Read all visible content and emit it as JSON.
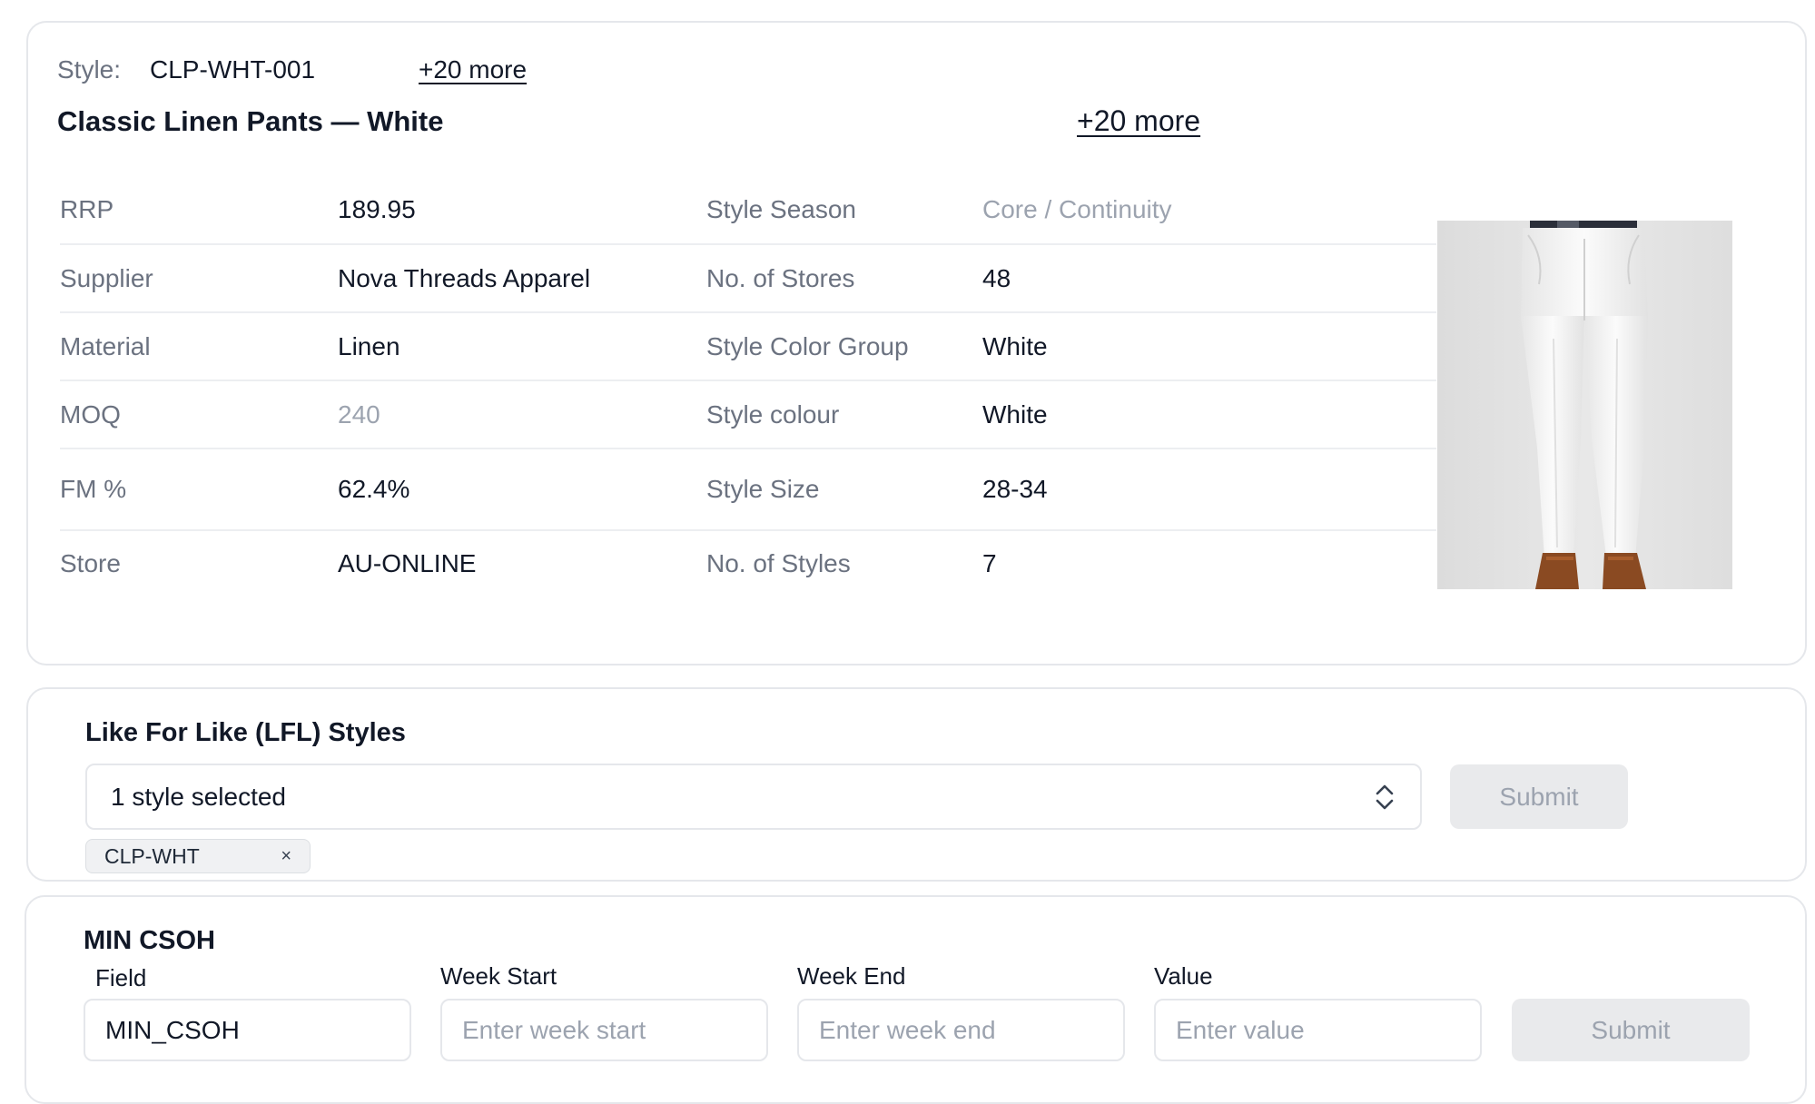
{
  "product": {
    "style_key": "Style:",
    "style_code": "CLP-WHT-001",
    "more_top": "+20 more",
    "title": "Classic Linen Pants — White",
    "more_title": "+20 more",
    "rows": [
      {
        "k1": "RRP",
        "v1": "189.95",
        "k2": "Style Season",
        "v2": "Core / Continuity"
      },
      {
        "k1": "Supplier",
        "v1": "Nova Threads Apparel",
        "k2": "No. of Stores",
        "v2": "48"
      },
      {
        "k1": "Material",
        "v1": "Linen",
        "k2": "Style Color Group",
        "v2": "White"
      },
      {
        "k1": "MOQ",
        "v1": "240",
        "k2": "Style colour",
        "v2": "White"
      },
      {
        "k1": "FM %",
        "v1": "62.4%",
        "k2": "Style Size",
        "v2": "28-34"
      },
      {
        "k1": "Store",
        "v1": "AU-ONLINE",
        "k2": "No. of Styles",
        "v2": "7"
      }
    ]
  },
  "lfl": {
    "title": "Like For Like (LFL) Styles",
    "select_value": "1 style selected",
    "submit_label": "Submit",
    "chip_label": "CLP-WHT",
    "chip_remove": "×"
  },
  "csoh": {
    "title": "MIN CSOH",
    "field_label": "Field",
    "field_value": "MIN_CSOH",
    "week_start_label": "Week Start",
    "week_start_placeholder": "Enter week start",
    "week_end_label": "Week End",
    "week_end_placeholder": "Enter week end",
    "value_label": "Value",
    "value_placeholder": "Enter value",
    "submit_label": "Submit"
  },
  "colors": {
    "text": "#111827",
    "muted": "#6b7280",
    "border": "#e5e7eb",
    "disabled_bg": "#e9eaec"
  }
}
